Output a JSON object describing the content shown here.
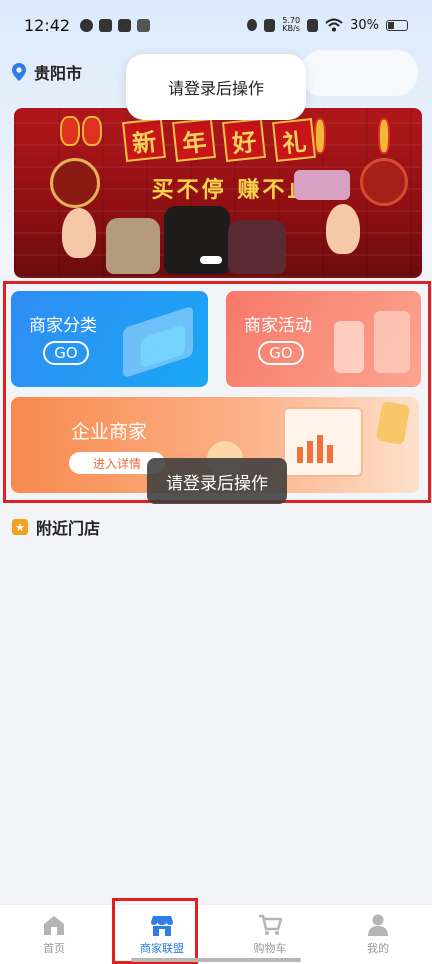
{
  "status_bar": {
    "time": "12:42",
    "net_speed_value": "5.70",
    "net_speed_unit": "KB/s",
    "battery": "30%"
  },
  "location": {
    "city": "贵阳市"
  },
  "toast_top": "请登录后操作",
  "toast_bottom": "请登录后操作",
  "banner": {
    "title_chars": [
      "新",
      "年",
      "好",
      "礼"
    ],
    "subtitle": "买不停 赚不止"
  },
  "cards": {
    "category": {
      "title": "商家分类",
      "button": "GO"
    },
    "activity": {
      "title": "商家活动",
      "button": "GO"
    },
    "enterprise": {
      "title": "企业商家",
      "button": "进入详情"
    }
  },
  "section": {
    "title": "附近门店"
  },
  "nav": {
    "items": [
      {
        "label": "首页",
        "icon": "home-icon"
      },
      {
        "label": "商家联盟",
        "icon": "store-icon"
      },
      {
        "label": "购物车",
        "icon": "cart-icon"
      },
      {
        "label": "我的",
        "icon": "user-icon"
      }
    ],
    "active_color": "#2f7de8",
    "inactive_color": "#999999"
  }
}
